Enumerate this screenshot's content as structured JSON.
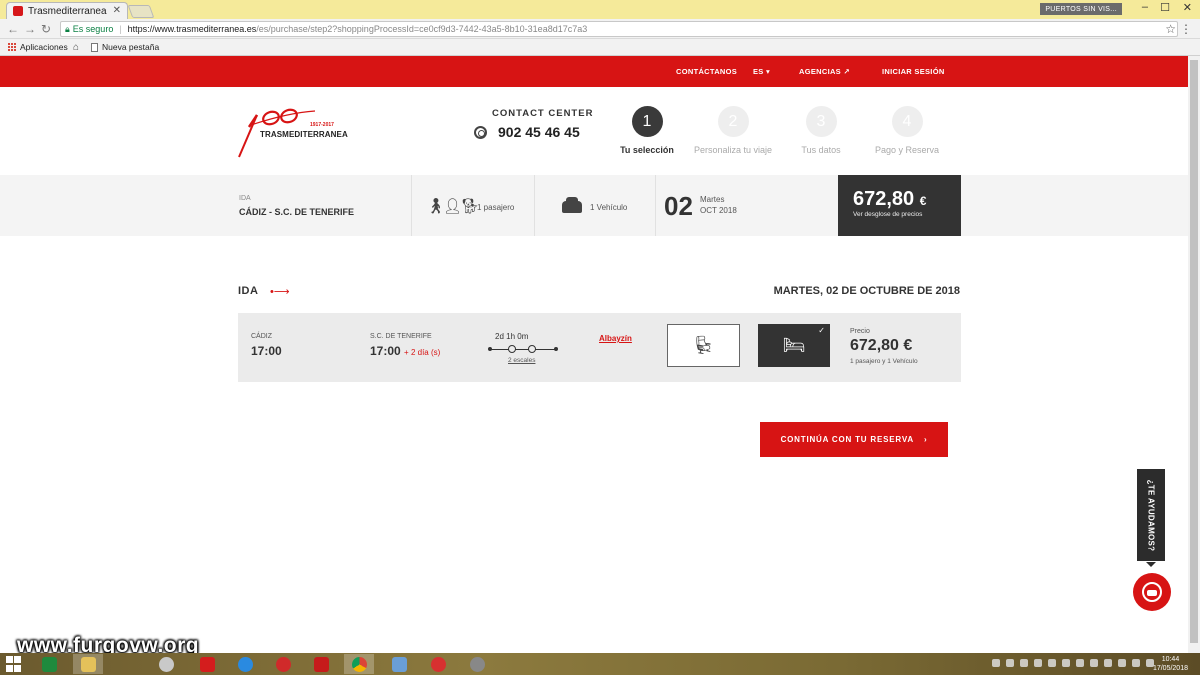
{
  "browser": {
    "tab_title": "Trasmediterranea",
    "tab_close": "✕",
    "profile": "PUERTOS SIN VIS...",
    "win_min": "–",
    "win_max": "☐",
    "win_close": "✕",
    "secure_label": "Es seguro",
    "url_host": "https://www.trasmediterranea.es",
    "url_path": "/es/purchase/step2?shoppingProcessId=ce0cf9d3-7442-43a5-8b10-31ea8d17c7a3",
    "bookmarks": [
      "Aplicaciones",
      "Nueva pestaña"
    ]
  },
  "topnav": {
    "contact": "CONTÁCTANOS",
    "lang": "ES",
    "agencies": "AGENCIAS",
    "login": "INICIAR SESIÓN"
  },
  "logo": {
    "brand": "TRASMEDITERRANEA",
    "years": "1917-2017"
  },
  "contact_center": {
    "title": "CONTACT CENTER",
    "phone": "902 45 46 45"
  },
  "steps": [
    {
      "num": "1",
      "label": "Tu selección"
    },
    {
      "num": "2",
      "label": "Personaliza tu viaje"
    },
    {
      "num": "3",
      "label": "Tus datos"
    },
    {
      "num": "4",
      "label": "Pago y Reserva"
    }
  ],
  "summary": {
    "direction": "IDA",
    "route": "CÁDIZ - S.C. DE TENERIFE",
    "passengers": "1 pasajero",
    "vehicles": "1 Vehículo",
    "day": "02",
    "weekday": "Martes",
    "month_year": "OCT 2018",
    "price": "672,80",
    "currency": "€",
    "price_link": "Ver desglose de precios"
  },
  "section": {
    "title": "IDA",
    "date": "MARTES, 02 DE OCTUBRE DE 2018"
  },
  "trip": {
    "origin": "CÁDIZ",
    "departure": "17:00",
    "destination": "S.C. DE TENERIFE",
    "arrival": "17:00",
    "arrival_plus": "+ 2 día (s)",
    "duration": "2d 1h 0m",
    "stops": "2 escales",
    "ship": "Albayzín",
    "price_label": "Precio",
    "price": "672,80 €",
    "price_sub": "1 pasajero y 1 Vehículo"
  },
  "continue_label": "CONTINÚA CON TU RESERVA",
  "help_label": "¿TE AYUDAMOS?",
  "watermark": "www.furgovw.org",
  "taskbar": {
    "time": "10:44",
    "date": "17/05/2018"
  },
  "colors": {
    "brand_red": "#d71414",
    "dark": "#333333"
  }
}
